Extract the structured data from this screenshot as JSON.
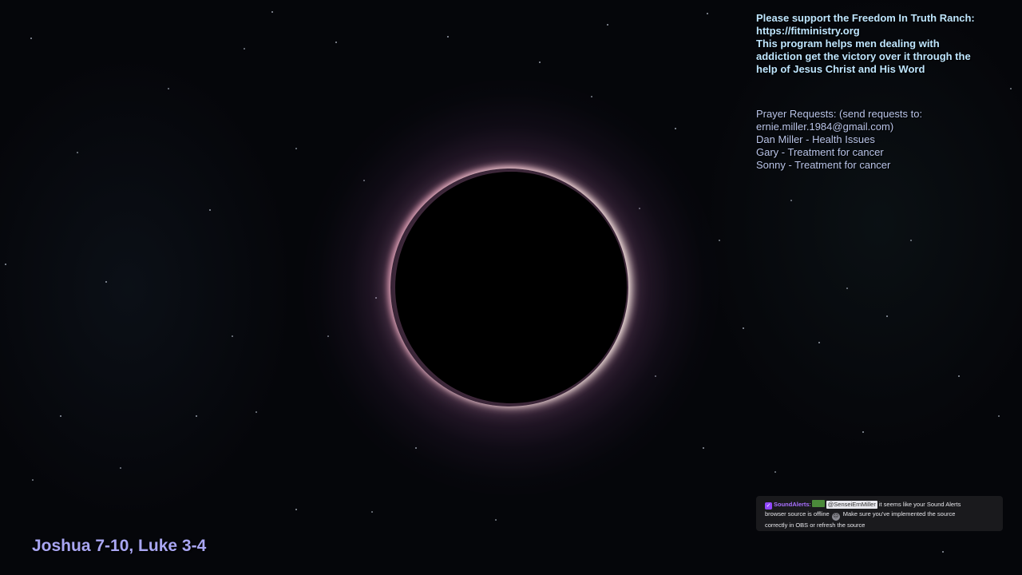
{
  "overlay": {
    "support": {
      "lines": [
        "Please support the Freedom In Truth Ranch:",
        "https://fitministry.org",
        "This program helps men dealing with",
        "addiction get the victory over it through the",
        "help of Jesus Christ and His Word"
      ]
    },
    "prayer": {
      "lines": [
        "Prayer Requests: (send requests to:",
        "ernie.miller.1984@gmail.com)",
        "Dan Miller - Health Issues",
        "Gary - Treatment for cancer",
        "Sonny - Treatment for cancer"
      ]
    },
    "scripture": "Joshua 7-10, Luke 3-4"
  },
  "alert": {
    "username": "SoundAlerts",
    "separator": ":",
    "mention": "@SenseiErnMiller",
    "message_line1": "it seems like your Sound Alerts",
    "message_line2a": "browser source is offline",
    "message_line2b": "Make sure you've implemented the source",
    "message_line3": "correctly in OBS or refresh the source"
  },
  "icons": {
    "badge": "verified-badge-icon",
    "emote": "emote-icon",
    "face": "face-emote-icon"
  },
  "colors": {
    "support_text": "#bfe6ff",
    "prayer_text": "#b9c4e8",
    "scripture_text": "#a9a6f2",
    "alert_username": "#a970ff",
    "alert_background": "#1c1c20"
  }
}
